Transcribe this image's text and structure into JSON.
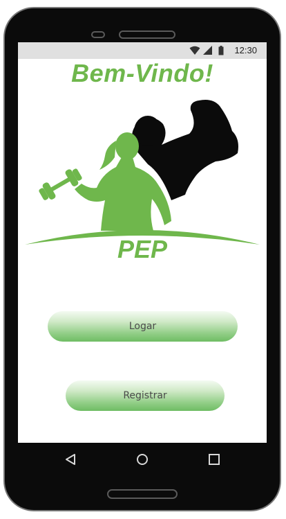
{
  "status_bar": {
    "time": "12:30",
    "icons": [
      "wifi-icon",
      "signal-icon",
      "battery-icon"
    ]
  },
  "welcome": {
    "title": "Bem-Vindo!"
  },
  "logo": {
    "text": "PEP",
    "colors": {
      "green": "#6fb74c",
      "dark": "#0b0b0b"
    }
  },
  "buttons": {
    "login": "Logar",
    "register": "Registrar"
  },
  "nav_bar": {
    "icons": [
      "back-icon",
      "home-icon",
      "recents-icon"
    ]
  },
  "theme": {
    "accent": "#6fb74c",
    "status_bar_bg": "#e0e0e0",
    "button_text": "#4a4a4a"
  }
}
